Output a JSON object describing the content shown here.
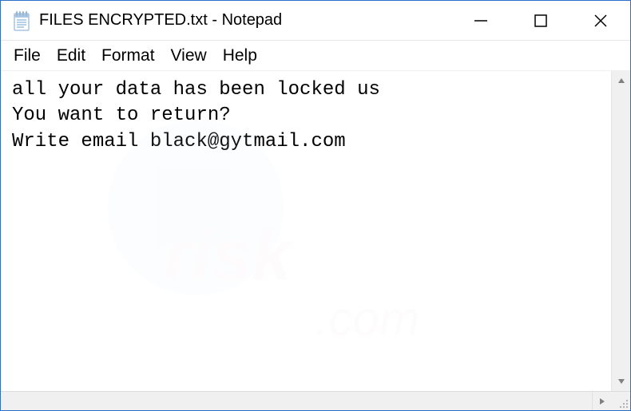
{
  "title": "FILES ENCRYPTED.txt - Notepad",
  "menu": {
    "file": "File",
    "edit": "Edit",
    "format": "Format",
    "view": "View",
    "help": "Help"
  },
  "content": "all your data has been locked us\nYou want to return?\nWrite email black@gytmail.com",
  "watermark_text": "pcrisk.com"
}
